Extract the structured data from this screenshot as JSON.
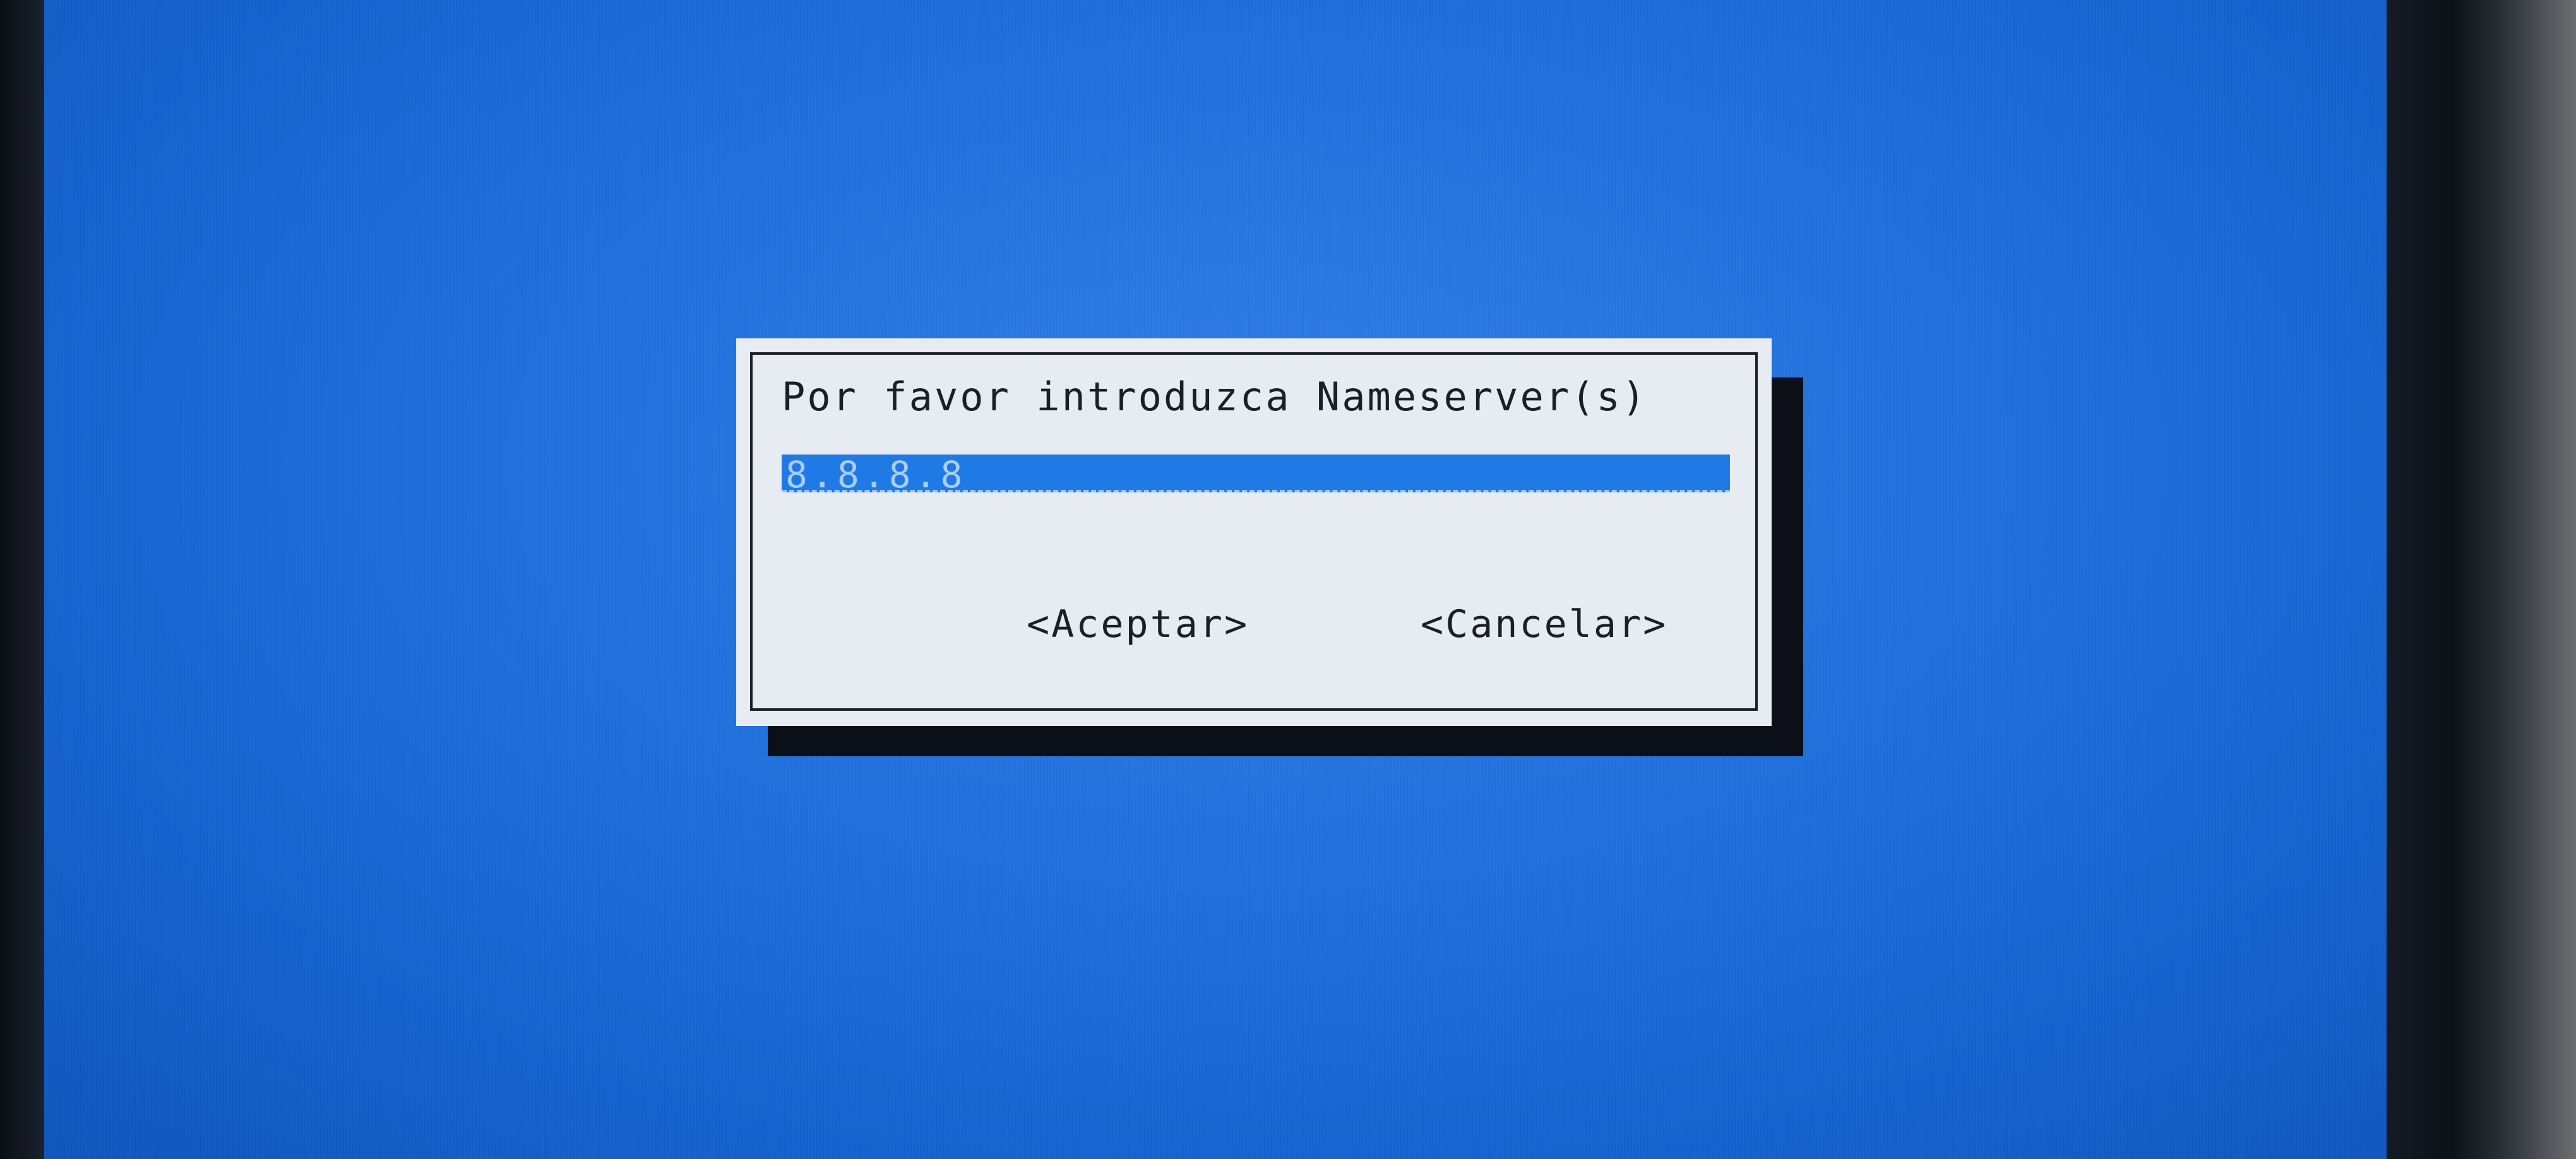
{
  "dialog": {
    "prompt": "Por favor introduzca Nameserver(s)",
    "nameserver_value": "8.8.8.8",
    "accept_label": "<Aceptar>",
    "cancel_label": "<Cancelar>"
  },
  "colors": {
    "screen_background": "#1f6fdd",
    "dialog_background": "#e7ecf3",
    "input_background": "#1f7ae6",
    "dialog_shadow": "#0a0f18"
  }
}
